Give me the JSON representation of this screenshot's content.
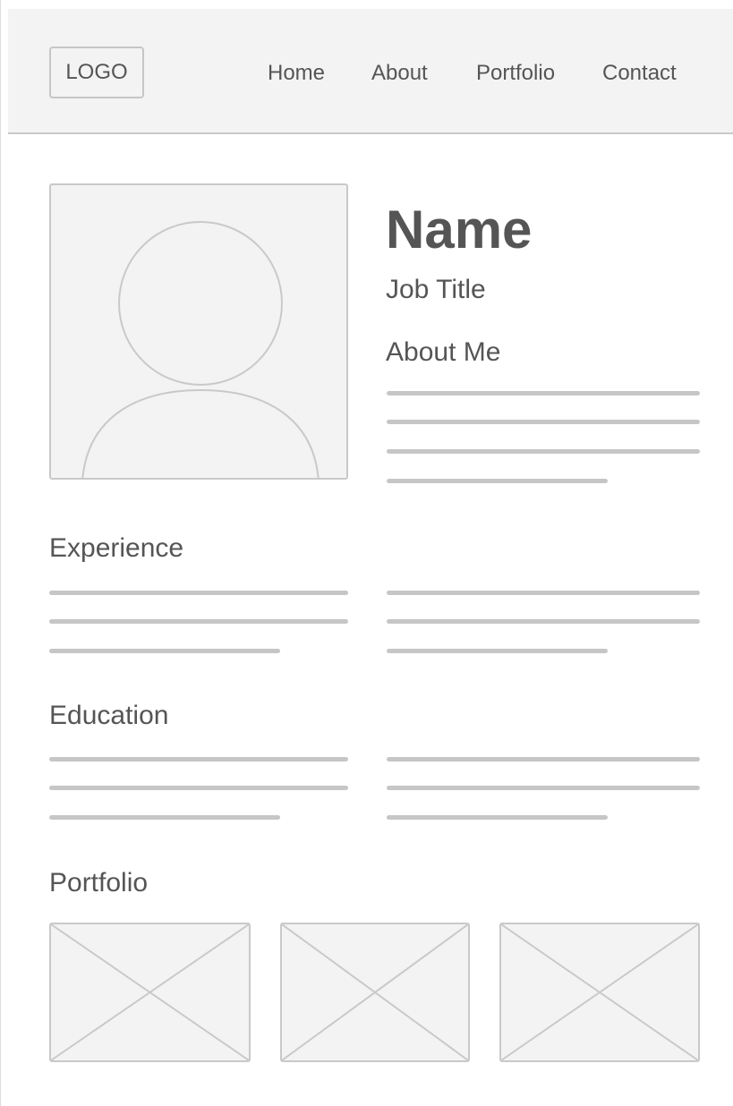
{
  "header": {
    "logo_text": "LOGO",
    "nav": [
      "Home",
      "About",
      "Portfolio",
      "Contact"
    ]
  },
  "profile": {
    "name": "Name",
    "job_title": "Job Title",
    "about_heading": "About Me",
    "photo_icon": "user-silhouette-icon"
  },
  "sections": {
    "experience": "Experience",
    "education": "Education",
    "portfolio": "Portfolio"
  },
  "portfolio_items": [
    {
      "icon": "image-placeholder-icon"
    },
    {
      "icon": "image-placeholder-icon"
    },
    {
      "icon": "image-placeholder-icon"
    }
  ],
  "colors": {
    "background": "#ffffff",
    "panel": "#f3f3f3",
    "stroke": "#c9c9c9",
    "text": "#555555"
  }
}
